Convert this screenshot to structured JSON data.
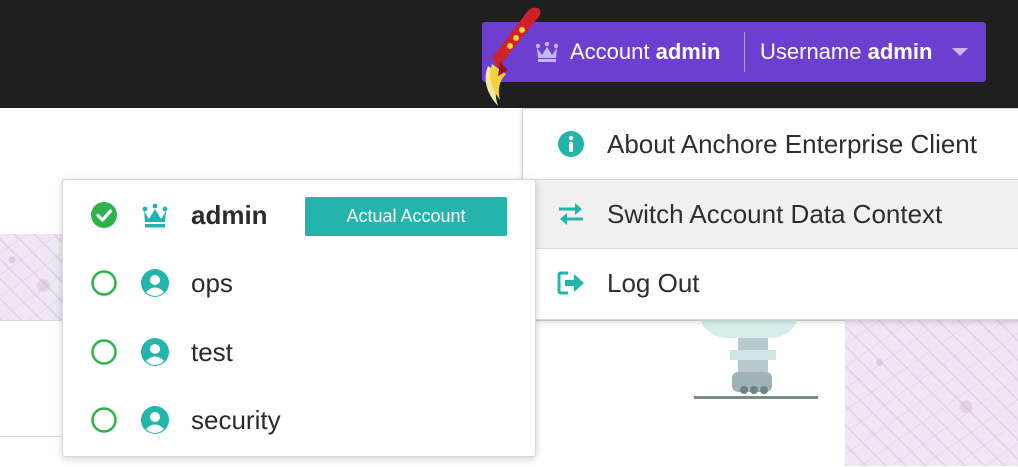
{
  "header": {
    "account_prefix": "Account",
    "account_name": "admin",
    "username_prefix": "Username",
    "username_value": "admin"
  },
  "user_menu": {
    "items": [
      {
        "label": "About Anchore Enterprise Client",
        "icon": "info-circle-icon"
      },
      {
        "label": "Switch Account Data Context",
        "icon": "exchange-arrows-icon"
      },
      {
        "label": "Log Out",
        "icon": "sign-out-icon"
      }
    ]
  },
  "account_switcher": {
    "accounts": [
      {
        "name": "admin",
        "selected": true,
        "icon": "crown-icon"
      },
      {
        "name": "ops",
        "selected": false,
        "icon": "user-circle-icon"
      },
      {
        "name": "test",
        "selected": false,
        "icon": "user-circle-icon"
      },
      {
        "name": "security",
        "selected": false,
        "icon": "user-circle-icon"
      }
    ],
    "actual_badge": "Actual Account"
  },
  "colors": {
    "topbar": "#1f1f1f",
    "chip": "#6c3fd0",
    "teal": "#23b4ab",
    "green_check": "#2fb24c"
  }
}
